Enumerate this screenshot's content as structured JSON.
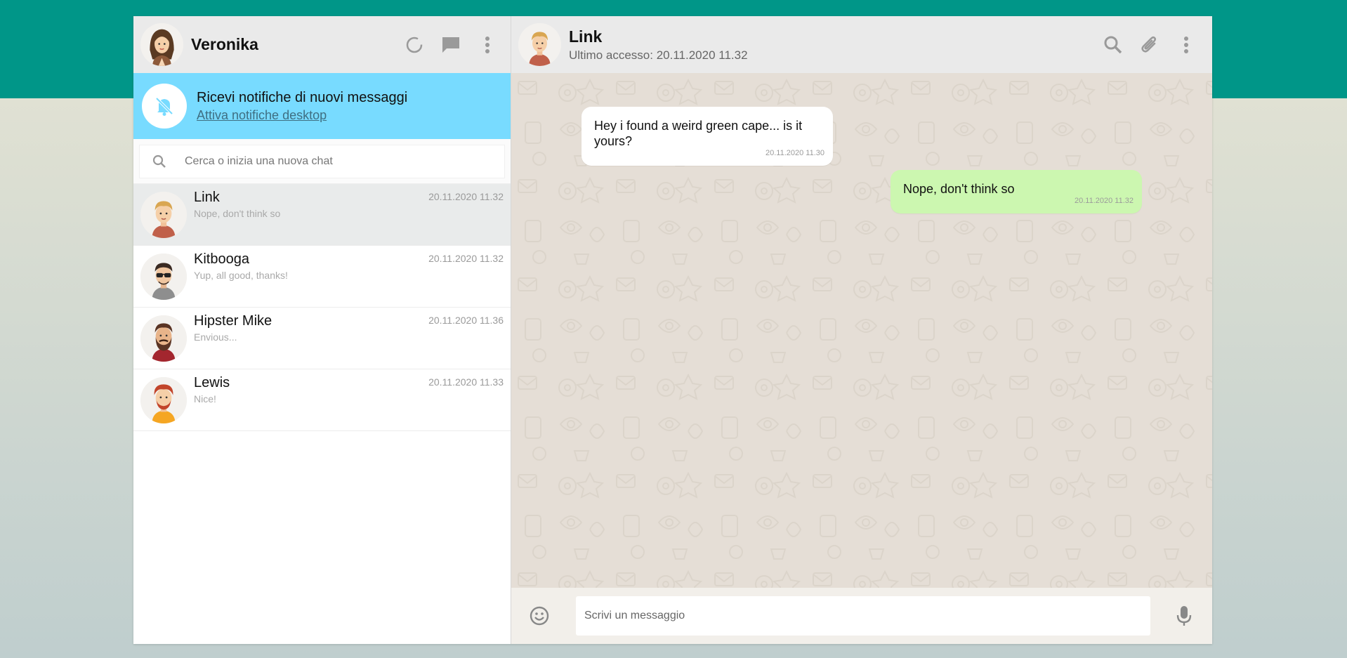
{
  "user": {
    "name": "Veronika"
  },
  "sidebar_icons": {
    "status": "status-icon",
    "new_chat": "new-chat-icon",
    "menu": "menu-dots-icon"
  },
  "notification": {
    "title": "Ricevi notifiche di nuovi messaggi",
    "link": "Attiva notifiche desktop"
  },
  "search": {
    "placeholder": "Cerca o inizia una nuova chat"
  },
  "chats": [
    {
      "name": "Link",
      "preview": "Nope, don't think so",
      "time": "20.11.2020 11.32",
      "active": true
    },
    {
      "name": "Kitbooga",
      "preview": "Yup, all good, thanks!",
      "time": "20.11.2020 11.32",
      "active": false
    },
    {
      "name": "Hipster Mike",
      "preview": "Envious...",
      "time": "20.11.2020 11.36",
      "active": false
    },
    {
      "name": "Lewis",
      "preview": "Nice!",
      "time": "20.11.2020 11.33",
      "active": false
    }
  ],
  "conversation": {
    "contact_name": "Link",
    "contact_status": "Ultimo accesso: 20.11.2020 11.32",
    "messages": [
      {
        "direction": "in",
        "text": "Hey i found a weird green cape... is it yours?",
        "time": "20.11.2020 11.30"
      },
      {
        "direction": "out",
        "text": "Nope, don't think so",
        "time": "20.11.2020 11.32"
      }
    ]
  },
  "composer": {
    "placeholder": "Scrivi un messaggio"
  },
  "colors": {
    "brand": "#009688",
    "notification_bg": "#78dbff",
    "outgoing_bubble": "#ccf7b0",
    "chat_bg": "#e5ded6"
  }
}
